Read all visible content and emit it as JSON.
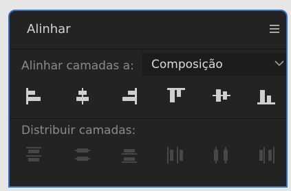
{
  "panel": {
    "title": "Alinhar",
    "menu_icon": "hamburger-menu-icon"
  },
  "align_layers": {
    "label": "Alinhar camadas a:",
    "target_selected": "Composição",
    "dropdown_icon": "chevron-down-icon",
    "buttons": [
      {
        "icon": "align-left-icon",
        "enabled": true
      },
      {
        "icon": "align-horizontal-center-icon",
        "enabled": true
      },
      {
        "icon": "align-right-icon",
        "enabled": true
      },
      {
        "icon": "align-top-icon",
        "enabled": true
      },
      {
        "icon": "align-vertical-center-icon",
        "enabled": true
      },
      {
        "icon": "align-bottom-icon",
        "enabled": true
      }
    ]
  },
  "distribute_layers": {
    "label": "Distribuir camadas:",
    "buttons": [
      {
        "icon": "distribute-top-icon",
        "enabled": false
      },
      {
        "icon": "distribute-vertical-center-icon",
        "enabled": false
      },
      {
        "icon": "distribute-bottom-icon",
        "enabled": false
      },
      {
        "icon": "distribute-left-icon",
        "enabled": false
      },
      {
        "icon": "distribute-horizontal-center-icon",
        "enabled": false
      },
      {
        "icon": "distribute-right-icon",
        "enabled": false
      }
    ]
  },
  "colors": {
    "panel_bg": "#232323",
    "focus_border": "#2f6fc5",
    "icon_enabled": "#cfcfcf",
    "icon_disabled": "#474747",
    "label_text": "#8a8a8a"
  }
}
